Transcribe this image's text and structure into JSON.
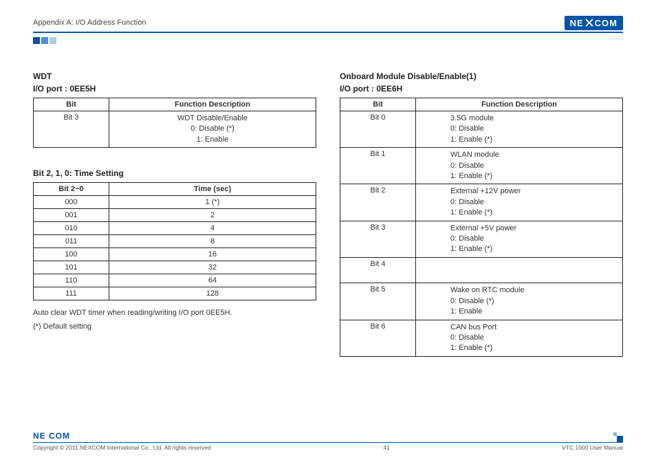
{
  "header": {
    "appendix": "Appendix A: I/O Address Function",
    "logo_text_left": "NE",
    "logo_text_right": "COM"
  },
  "left": {
    "heading_line1": "WDT",
    "heading_line2": "I/O port : 0EE5H",
    "table1": {
      "headers": [
        "Bit",
        "Function Description"
      ],
      "bit": "Bit 3",
      "desc": "WDT Disable/Enable\n0: Disable (*)\n1: Enable"
    },
    "sub_heading": "Bit 2, 1, 0: Time Setting",
    "table2": {
      "headers": [
        "Bit 2~0",
        "Time (sec)"
      ],
      "rows": [
        {
          "bits": "000",
          "time": "1 (*)"
        },
        {
          "bits": "001",
          "time": "2"
        },
        {
          "bits": "010",
          "time": "4"
        },
        {
          "bits": "011",
          "time": "8"
        },
        {
          "bits": "100",
          "time": "16"
        },
        {
          "bits": "101",
          "time": "32"
        },
        {
          "bits": "110",
          "time": "64"
        },
        {
          "bits": "111",
          "time": "128"
        }
      ]
    },
    "note1": "Auto clear WDT timer when reading/writing I/O port 0EE5H.",
    "note2": "(*) Default setting"
  },
  "right": {
    "heading_line1": "Onboard Module Disable/Enable(1)",
    "heading_line2": "I/O port : 0EE6H",
    "table": {
      "headers": [
        "Bit",
        "Function Description"
      ],
      "rows": [
        {
          "bit": "Bit 0",
          "desc": "3.5G module\n0: Disable\n1: Enable (*)"
        },
        {
          "bit": "Bit 1",
          "desc": "WLAN module\n0: Disable\n1: Enable (*)"
        },
        {
          "bit": "Bit 2",
          "desc": "External +12V power\n0: Disable\n1: Enable (*)"
        },
        {
          "bit": "Bit 3",
          "desc": "External +5V power\n0: Disable\n1: Enable (*)"
        },
        {
          "bit": "Bit 4",
          "desc": "\n\n"
        },
        {
          "bit": "Bit 5",
          "desc": "Wake on RTC module\n0: Disable (*)\n1: Enable"
        },
        {
          "bit": "Bit 6",
          "desc": "CAN bus Port\n0: Disable\n1: Enable (*)"
        }
      ]
    }
  },
  "footer": {
    "logo": "NE COM",
    "copyright": "Copyright © 2011 NEXCOM International Co., Ltd. All rights reserved",
    "page_number": "41",
    "manual": "VTC 1000 User Manual"
  }
}
